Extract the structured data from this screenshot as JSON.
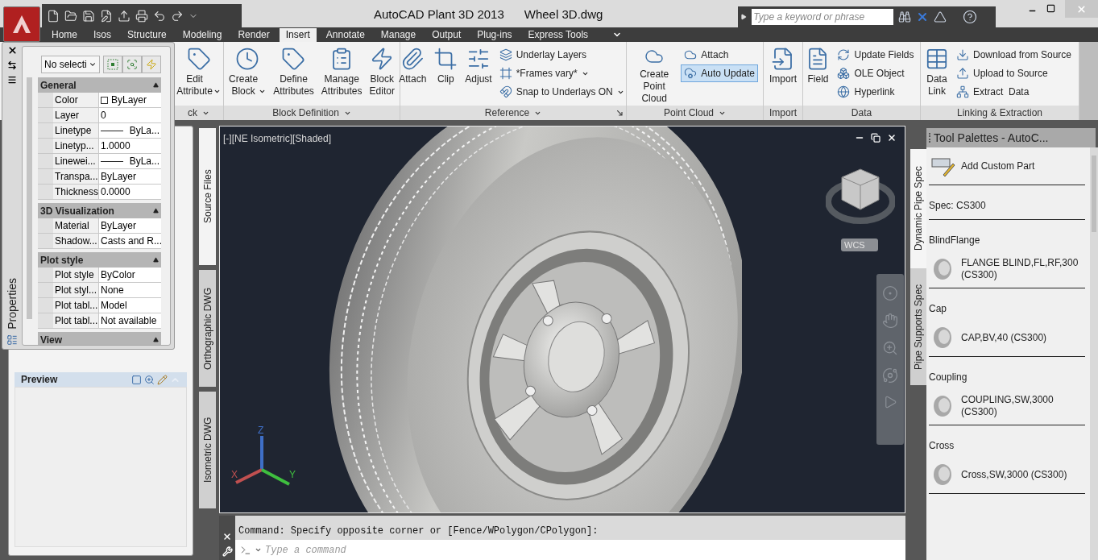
{
  "title_bar": {
    "app_name": "AutoCAD Plant 3D 2013",
    "document": "Wheel 3D.dwg",
    "search": {
      "placeholder": "Type a keyword or phrase"
    }
  },
  "ribbon": {
    "tabs": [
      {
        "label": "Home",
        "selected": false
      },
      {
        "label": "Isos",
        "selected": false
      },
      {
        "label": "Structure",
        "selected": false
      },
      {
        "label": "Modeling",
        "selected": false
      },
      {
        "label": "Render",
        "selected": false
      },
      {
        "label": "Insert",
        "selected": true
      },
      {
        "label": "Annotate",
        "selected": false
      },
      {
        "label": "Manage",
        "selected": false
      },
      {
        "label": "Output",
        "selected": false
      },
      {
        "label": "Plug-ins",
        "selected": false
      },
      {
        "label": "Express Tools",
        "selected": false
      }
    ],
    "panels": [
      {
        "title": "ck",
        "menu": true,
        "tools": [
          {
            "kind": "large",
            "label": "Edit\nAttribute",
            "dropdown": true
          }
        ]
      },
      {
        "title": "Block Definition",
        "menu": true,
        "tools": [
          {
            "kind": "large",
            "label": "Create\nBlock",
            "dropdown": true
          },
          {
            "kind": "large",
            "label": "Define\nAttributes"
          },
          {
            "kind": "large",
            "label": "Manage\nAttributes"
          },
          {
            "kind": "large",
            "label": "Block\nEditor"
          }
        ]
      },
      {
        "title": "Reference",
        "menu": true,
        "launcher": true,
        "tools": [
          {
            "kind": "large",
            "label": "Attach"
          },
          {
            "kind": "large",
            "label": "Clip"
          },
          {
            "kind": "large",
            "label": "Adjust"
          },
          {
            "kind": "small",
            "label": "Underlay Layers"
          },
          {
            "kind": "small",
            "label": "*Frames vary*",
            "dropdown": true
          },
          {
            "kind": "small",
            "label": "Snap to Underlays ON",
            "dropdown": true
          }
        ]
      },
      {
        "title": "Point Cloud",
        "menu": true,
        "tools": [
          {
            "kind": "large",
            "label": "Create\nPoint Cloud"
          },
          {
            "kind": "small",
            "label": "Attach"
          },
          {
            "kind": "small",
            "label": "Auto Update",
            "on": true
          }
        ]
      },
      {
        "title": "Import",
        "tools": [
          {
            "kind": "large",
            "label": "Import"
          }
        ]
      },
      {
        "title": "Data",
        "tools": [
          {
            "kind": "large",
            "label": "Field"
          },
          {
            "kind": "small",
            "label": "Update Fields"
          },
          {
            "kind": "small",
            "label": "OLE Object"
          },
          {
            "kind": "small",
            "label": "Hyperlink"
          }
        ]
      },
      {
        "title": "Linking & Extraction",
        "tools": [
          {
            "kind": "large",
            "label": "Data\nLink"
          },
          {
            "kind": "small",
            "label": "Download from Source"
          },
          {
            "kind": "small",
            "label": "Upload to Source"
          },
          {
            "kind": "small",
            "label": "Extract  Data"
          }
        ]
      }
    ]
  },
  "properties": {
    "title": "Properties",
    "selection": "No selecti",
    "sections": [
      {
        "title": "General",
        "rows": [
          {
            "kind": "swatch",
            "name": "Color",
            "value": "ByLayer"
          },
          {
            "kind": "text",
            "name": "Layer",
            "value": "0"
          },
          {
            "kind": "line",
            "name": "Linetype",
            "value": "ByLa..."
          },
          {
            "kind": "text",
            "name": "Linetyp...",
            "value": "1.0000"
          },
          {
            "kind": "line",
            "name": "Linewei...",
            "value": "ByLa..."
          },
          {
            "kind": "text",
            "name": "Transpa...",
            "value": "ByLayer"
          },
          {
            "kind": "text",
            "name": "Thickness",
            "value": "0.0000"
          }
        ]
      },
      {
        "title": "3D Visualization",
        "rows": [
          {
            "kind": "text",
            "name": "Material",
            "value": "ByLayer"
          },
          {
            "kind": "text",
            "name": "Shadow...",
            "value": "Casts and R..."
          }
        ]
      },
      {
        "title": "Plot style",
        "rows": [
          {
            "kind": "text",
            "name": "Plot style",
            "value": "ByColor"
          },
          {
            "kind": "text",
            "name": "Plot styl...",
            "value": "None"
          },
          {
            "kind": "text",
            "name": "Plot tabl...",
            "value": "Model"
          },
          {
            "kind": "text",
            "name": "Plot tabl...",
            "value": "Not available"
          }
        ]
      },
      {
        "title": "View"
      }
    ]
  },
  "preview": {
    "title": "Preview"
  },
  "drawing_tabs": [
    {
      "label": "Source Files",
      "selected": true
    },
    {
      "label": "Orthographic DWG",
      "selected": false
    },
    {
      "label": "Isometric DWG",
      "selected": false
    }
  ],
  "viewport": {
    "label": "[-][NE Isometric][Shaded]",
    "ucs_menu": "WCS",
    "axes": [
      "X",
      "Y",
      "Z"
    ]
  },
  "command_line": {
    "history": "Command: Specify opposite corner or [Fence/WPolygon/CPolygon]:",
    "placeholder": "Type a command"
  },
  "tool_palette": {
    "title": "Tool Palettes - AutoC...",
    "tabs": [
      {
        "label": "Dynamic Pipe Spec",
        "selected": true
      },
      {
        "label": "Pipe Supports Spec",
        "selected": false
      }
    ],
    "groups": [
      {
        "tools": [
          "Add Custom Part"
        ]
      },
      {
        "heading": "Spec: CS300"
      },
      {
        "heading": "BlindFlange",
        "tools": [
          "FLANGE BLIND,FL,RF,300 (CS300)"
        ]
      },
      {
        "heading": "Cap",
        "tools": [
          "CAP,BV,40 (CS300)"
        ]
      },
      {
        "heading": "Coupling",
        "tools": [
          "COUPLING,SW,3000 (CS300)"
        ]
      },
      {
        "heading": "Cross",
        "tools": [
          "Cross,SW,3000 (CS300)"
        ]
      }
    ]
  }
}
